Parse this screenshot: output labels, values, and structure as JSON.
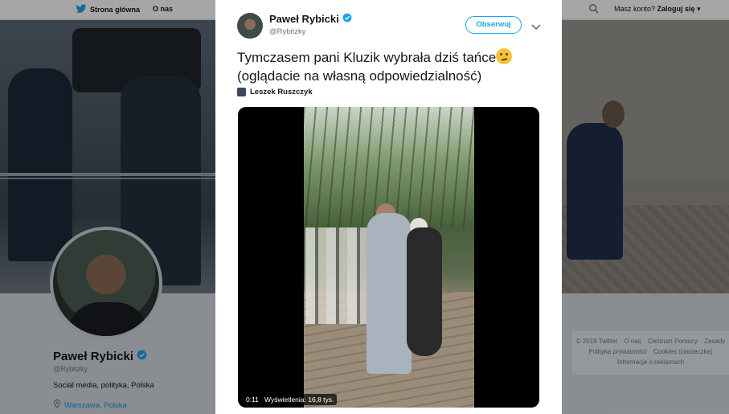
{
  "nav": {
    "home_label": "Strona główna",
    "about_label": "O nas",
    "account_prompt": "Masz konto?",
    "login_label": "Zaloguj się"
  },
  "profile": {
    "name": "Paweł Rybicki",
    "handle": "@Rybitzky",
    "bio": "Social media, polityka, Polska",
    "location": "Warszawa, Polska"
  },
  "footer": {
    "items": [
      "© 2019 Twitter",
      "O nas",
      "Centrum Pomocy",
      "Zasady",
      "Polityka prywatności",
      "Cookies (ciasteczka)",
      "Informacje o reklamach"
    ]
  },
  "tweet": {
    "author_name": "Paweł Rybicki",
    "author_handle": "@Rybitzky",
    "follow_label": "Obserwuj",
    "text": "Tymczasem pani Kluzik wybrała dziś tańce",
    "text_line2": "(oglądacie na własną odpowiedzialność)",
    "mention": "Leszek Ruszczyk",
    "video": {
      "time": "0:11",
      "views": "Wyświetlenia: 16,8 tys."
    }
  },
  "colors": {
    "accent": "#1da1f2",
    "verified": "#1da1f2"
  },
  "icons": [
    "twitter-bird-icon",
    "search-icon",
    "verified-badge-icon",
    "chevron-down-icon",
    "location-pin-icon",
    "thinking-face-emoji"
  ]
}
